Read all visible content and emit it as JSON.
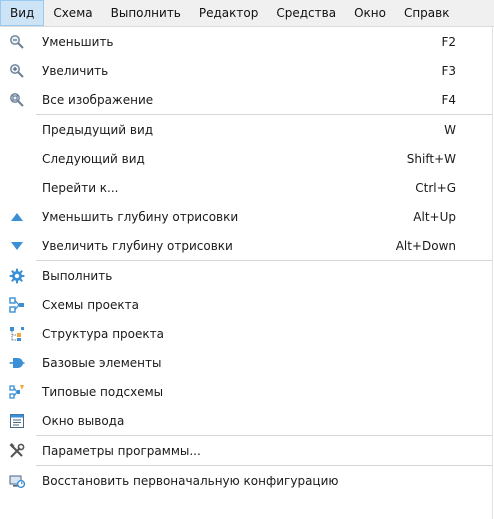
{
  "menubar": {
    "items": [
      {
        "label": "Вид",
        "active": true
      },
      {
        "label": "Схема"
      },
      {
        "label": "Выполнить"
      },
      {
        "label": "Редактор"
      },
      {
        "label": "Средства"
      },
      {
        "label": "Окно"
      },
      {
        "label": "Справк"
      }
    ]
  },
  "menu": {
    "items": [
      {
        "label": "Уменьшить",
        "shortcut": "F2",
        "icon": "zoom-out-icon"
      },
      {
        "label": "Увеличить",
        "shortcut": "F3",
        "icon": "zoom-in-icon"
      },
      {
        "label": "Все изображение",
        "shortcut": "F4",
        "icon": "zoom-fit-icon"
      },
      {
        "label": "Предыдущий вид",
        "shortcut": "W",
        "icon": ""
      },
      {
        "label": "Следующий вид",
        "shortcut": "Shift+W",
        "icon": ""
      },
      {
        "label": "Перейти к...",
        "shortcut": "Ctrl+G",
        "icon": ""
      },
      {
        "label": "Уменьшить глубину отрисовки",
        "shortcut": "Alt+Up",
        "icon": "triangle-up-icon"
      },
      {
        "label": "Увеличить глубину отрисовки",
        "shortcut": "Alt+Down",
        "icon": "triangle-down-icon"
      },
      {
        "label": "Выполнить",
        "shortcut": "",
        "icon": "gear-icon"
      },
      {
        "label": "Схемы проекта",
        "shortcut": "",
        "icon": "project-schemes-icon"
      },
      {
        "label": "Структура проекта",
        "shortcut": "",
        "icon": "project-structure-icon"
      },
      {
        "label": "Базовые элементы",
        "shortcut": "",
        "icon": "base-elements-icon"
      },
      {
        "label": "Типовые подсхемы",
        "shortcut": "",
        "icon": "typical-subschemes-icon"
      },
      {
        "label": "Окно вывода",
        "shortcut": "",
        "icon": "output-window-icon"
      },
      {
        "label": "Параметры программы...",
        "shortcut": "",
        "icon": "tools-icon"
      },
      {
        "label": "Восстановить первоначальную конфигурацию",
        "shortcut": "",
        "icon": "restore-config-icon"
      }
    ]
  },
  "colors": {
    "active_menu_bg": "#cde4f7",
    "active_menu_border": "#99c9ef",
    "icon_blue": "#3a8fd6"
  }
}
